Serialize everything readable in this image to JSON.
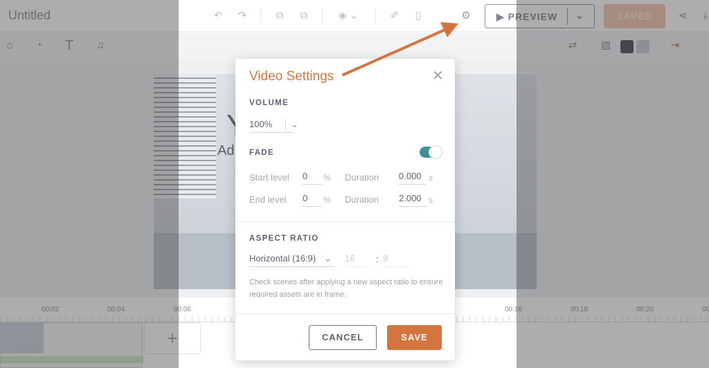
{
  "header": {
    "title": "Untitled",
    "preview_label": "PREVIEW",
    "saved_label": "SAVED"
  },
  "toolbar": {
    "icons": [
      "undo-icon",
      "redo-icon",
      "duplicate-icon",
      "copy-to-icon",
      "layers-icon",
      "clean-icon",
      "trash-icon",
      "gear-icon",
      "share-icon",
      "download-icon"
    ]
  },
  "tools_row": {
    "icons": [
      "furniture-icon",
      "chart-icon",
      "text-icon",
      "music-icon",
      "swap-icon",
      "image-icon",
      "color-swatch-dark",
      "color-swatch-light",
      "enter-icon"
    ],
    "swatches": [
      "#4a4f57",
      "#c7ccd3"
    ]
  },
  "scene": {
    "text_large": "Y",
    "text_small": "Ad"
  },
  "timeline": {
    "ticks": [
      "00:02",
      "00:04",
      "00:06",
      "00:16",
      "00:18",
      "00:20",
      "00"
    ],
    "add_label": "+"
  },
  "modal": {
    "title": "Video Settings",
    "volume": {
      "label": "VOLUME",
      "value": "100%"
    },
    "fade": {
      "label": "FADE",
      "enabled": true,
      "start_label": "Start level",
      "start_value": "0",
      "start_unit": "%",
      "start_duration_label": "Duration",
      "start_duration": "0.000",
      "start_duration_unit": "s",
      "end_label": "End level",
      "end_value": "0",
      "end_unit": "%",
      "end_duration_label": "Duration",
      "end_duration": "2.000",
      "end_duration_unit": "s"
    },
    "aspect": {
      "label": "ASPECT RATIO",
      "value": "Horizontal (16:9)",
      "width_placeholder": "16",
      "sep": ":",
      "height_placeholder": "9",
      "note": "Check scenes after applying a new aspect ratio to ensure required assets are in frame."
    },
    "cancel_label": "CANCEL",
    "save_label": "SAVE"
  },
  "colors": {
    "accent": "#d4753f",
    "toggle": "#3f8f98"
  }
}
